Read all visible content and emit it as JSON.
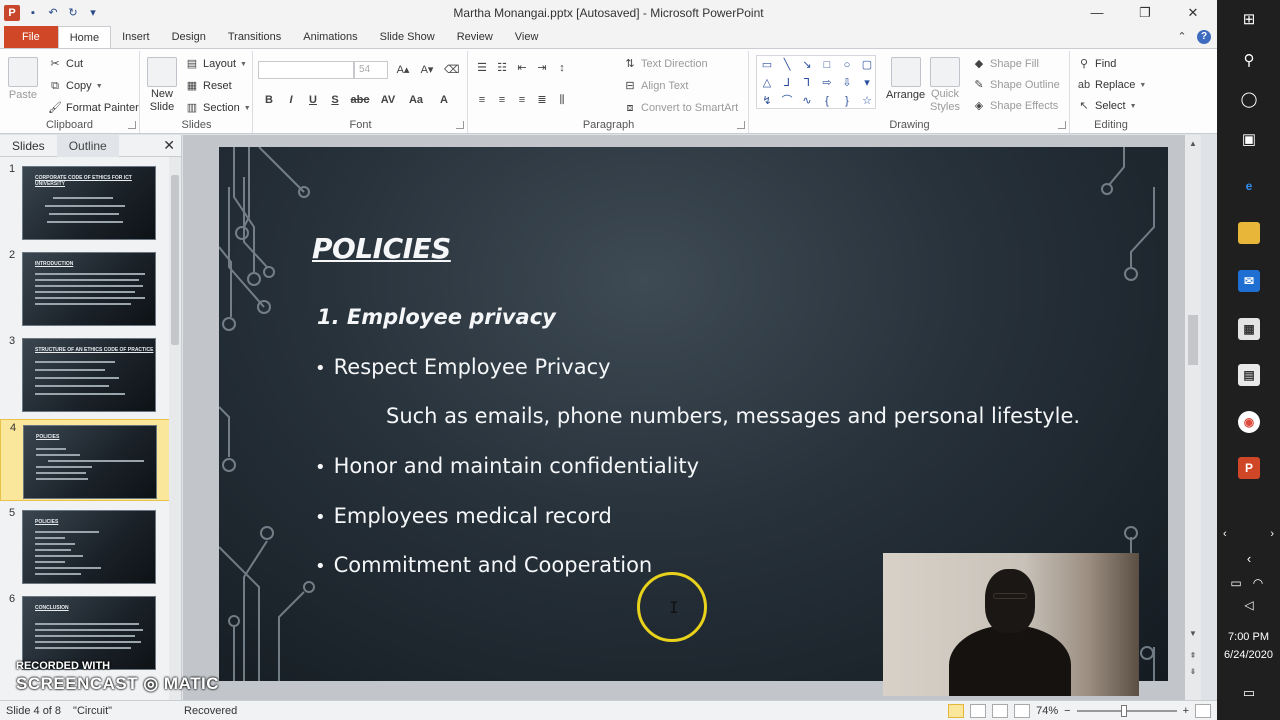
{
  "window": {
    "title": "Martha Monangai.pptx [Autosaved] - Microsoft PowerPoint",
    "app_logo": "P",
    "minimize": "—",
    "restore": "❐",
    "close": "✕"
  },
  "tabs": [
    "File",
    "Home",
    "Insert",
    "Design",
    "Transitions",
    "Animations",
    "Slide Show",
    "Review",
    "View"
  ],
  "ribbon": {
    "clipboard": {
      "label": "Clipboard",
      "paste": "Paste",
      "cut": "Cut",
      "copy": "Copy",
      "format_painter": "Format Painter"
    },
    "slides": {
      "label": "Slides",
      "new_slide_line1": "New",
      "new_slide_line2": "Slide",
      "layout": "Layout",
      "reset": "Reset",
      "section": "Section"
    },
    "font": {
      "label": "Font",
      "size": "54",
      "bold": "B",
      "italic": "I",
      "underline": "U",
      "strike": "S",
      "abc": "abc",
      "spacing": "AV",
      "case": "Aa",
      "color": "A"
    },
    "paragraph": {
      "label": "Paragraph",
      "text_direction": "Text Direction",
      "align_text": "Align Text",
      "smartart": "Convert to SmartArt"
    },
    "drawing": {
      "label": "Drawing",
      "arrange": "Arrange",
      "quick_styles_line1": "Quick",
      "quick_styles_line2": "Styles",
      "shape_fill": "Shape Fill",
      "shape_outline": "Shape Outline",
      "shape_effects": "Shape Effects"
    },
    "editing": {
      "label": "Editing",
      "find": "Find",
      "replace": "Replace",
      "select": "Select"
    }
  },
  "slide_pane": {
    "tabs": [
      "Slides",
      "Outline"
    ],
    "thumbnails": [
      {
        "num": "1",
        "title": "CORPORATE CODE OF ETHICS FOR ICT UNIVERSITY"
      },
      {
        "num": "2",
        "title": "INTRODUCTION"
      },
      {
        "num": "3",
        "title": "STRUCTURE OF AN ETHICS CODE OF PRACTICE"
      },
      {
        "num": "4",
        "title": "POLICIES"
      },
      {
        "num": "5",
        "title": "POLICIES"
      },
      {
        "num": "6",
        "title": "CONCLUSION"
      }
    ]
  },
  "slide": {
    "title": "POLICIES",
    "subtitle": "1. Employee privacy",
    "bullets": [
      "Respect Employee Privacy",
      "Honor and maintain confidentiality",
      "Employees medical record",
      "Commitment and Cooperation"
    ],
    "indent_text": "Such as emails, phone numbers, messages and personal lifestyle."
  },
  "statusbar": {
    "slide_info": "Slide 4 of 8",
    "theme": "\"Circuit\"",
    "recovered": "Recovered",
    "zoom": "74%",
    "zoom_out": "−",
    "zoom_in": "+"
  },
  "watermark": {
    "line1": "RECORDED WITH",
    "line2": "SCREENCAST ◎ MATIC"
  },
  "system": {
    "time": "7:00 PM",
    "date": "6/24/2020"
  }
}
